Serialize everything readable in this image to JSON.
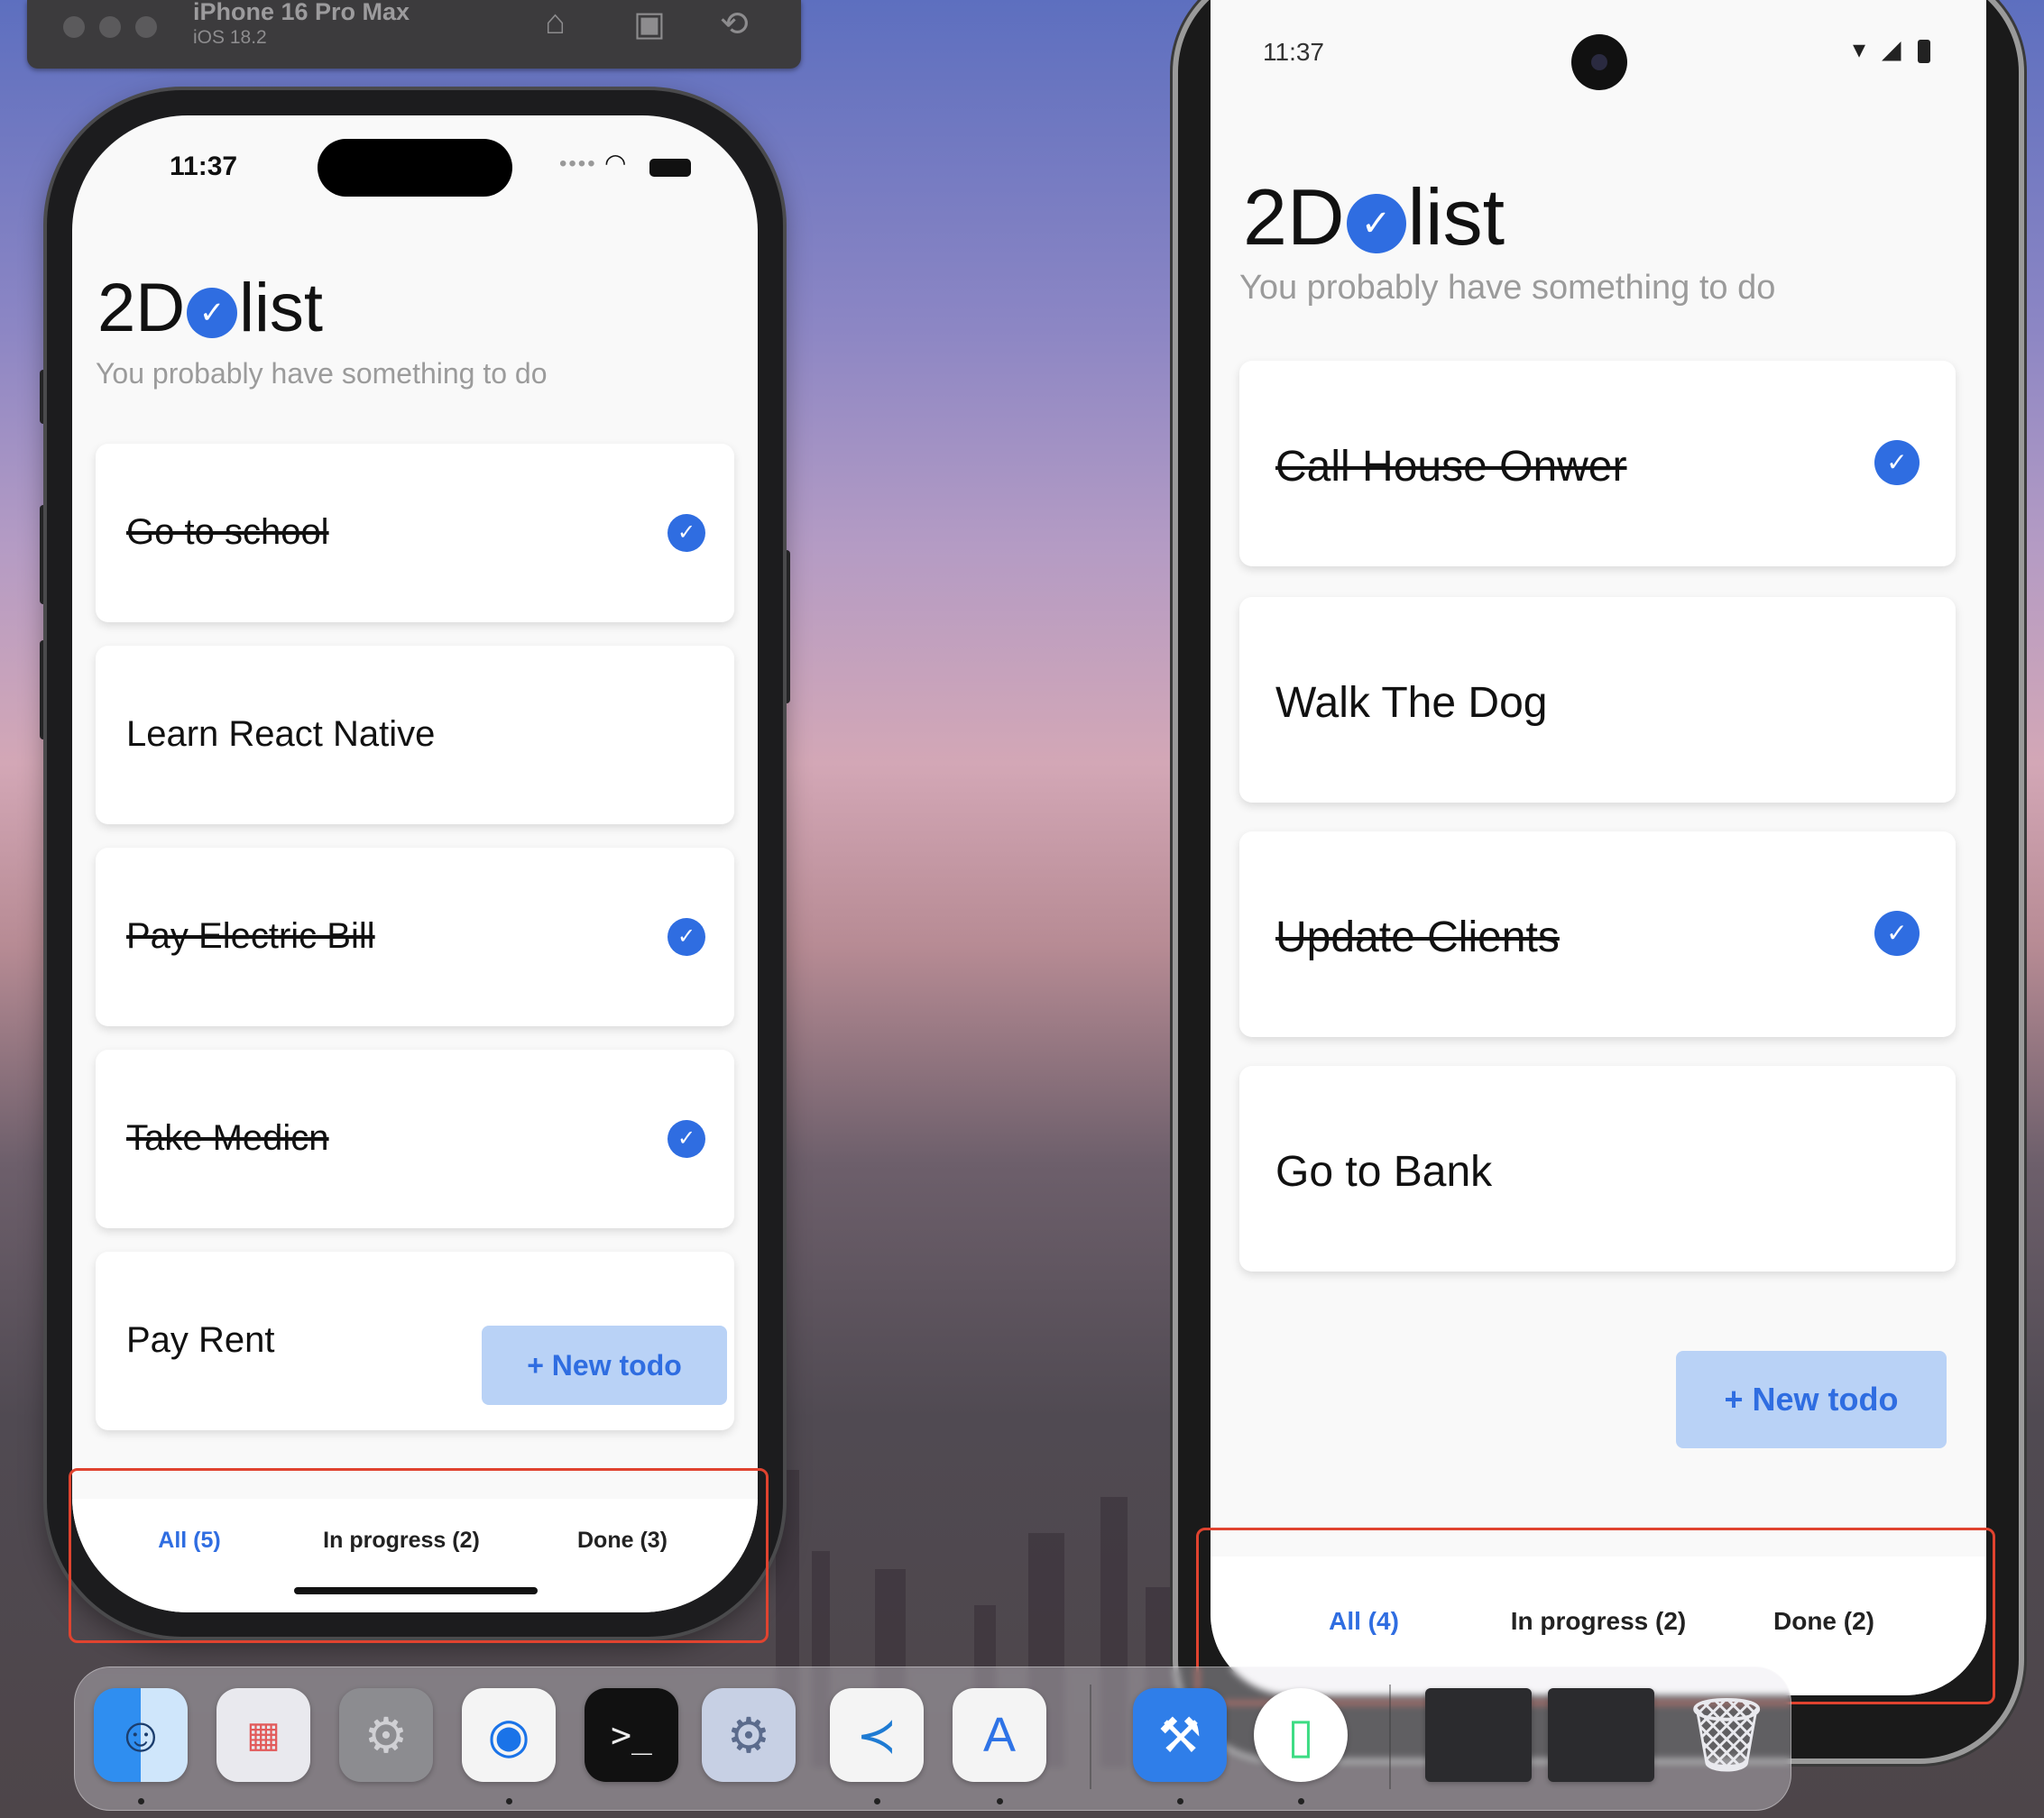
{
  "simulator": {
    "device_name": "iPhone 16 Pro Max",
    "os_version": "iOS 18.2"
  },
  "ios": {
    "status_time": "11:37",
    "brand_prefix": "2D",
    "brand_suffix": "list",
    "tagline": "You probably have something to do",
    "todos": [
      {
        "title": "Go to school",
        "done": true
      },
      {
        "title": "Learn React Native",
        "done": false
      },
      {
        "title": "Pay Electric Bill",
        "done": true
      },
      {
        "title": "Take Medicn",
        "done": true
      },
      {
        "title": "Pay Rent",
        "done": false
      }
    ],
    "new_todo_label": "+ New todo",
    "tabs": [
      "All (5)",
      "In progress (2)",
      "Done (3)"
    ],
    "active_tab": 0
  },
  "android": {
    "status_time": "11:37",
    "brand_prefix": "2D",
    "brand_suffix": "list",
    "tagline": "You probably have something to do",
    "todos": [
      {
        "title": "Call House Onwer",
        "done": true
      },
      {
        "title": "Walk The Dog",
        "done": false
      },
      {
        "title": "Update Clients ",
        "done": true
      },
      {
        "title": "Go to Bank",
        "done": false
      }
    ],
    "new_todo_label": "+ New todo",
    "tabs": [
      "All (4)",
      "In progress (2)",
      "Done (2)"
    ],
    "active_tab": 0
  },
  "dock": {
    "apps": [
      "finder-icon",
      "launchpad-icon",
      "system-settings-icon",
      "chrome-icon",
      "terminal-icon",
      "gear-utility-icon",
      "vscode-icon",
      "android-studio-icon",
      "xcode-icon",
      "android-emulator-icon",
      "window-thumbnail-icon",
      "window-thumbnail-icon",
      "trash-icon"
    ]
  },
  "colors": {
    "accent": "#2f6de1",
    "new_todo_bg": "#b9d2f6",
    "highlight": "#e0432f"
  }
}
